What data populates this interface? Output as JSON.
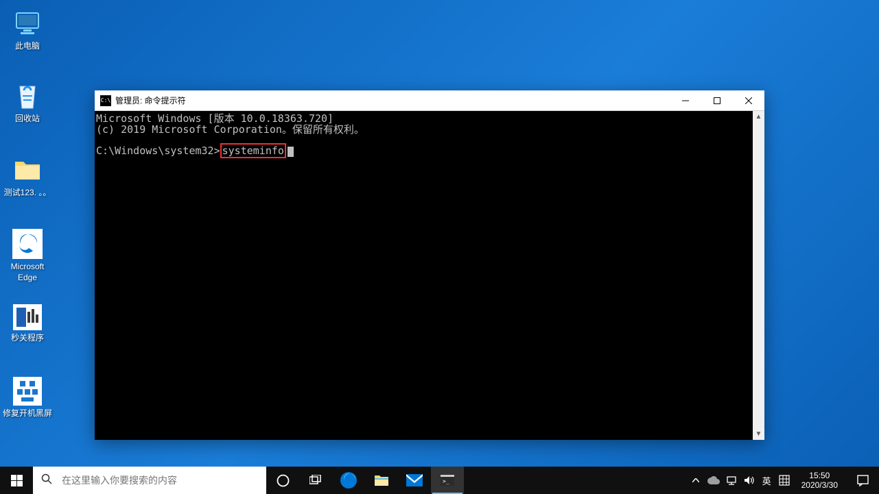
{
  "desktop": {
    "icons": [
      {
        "name": "此电脑",
        "icon": "pc"
      },
      {
        "name": "回收站",
        "icon": "recycle"
      },
      {
        "name": "测试123. 。。",
        "icon": "folder"
      },
      {
        "name": "Microsoft Edge",
        "icon": "edge"
      },
      {
        "name": "秒关程序",
        "icon": "app1"
      },
      {
        "name": "修复开机黑屏",
        "icon": "app2"
      }
    ]
  },
  "cmd": {
    "title_icon": "C:\\",
    "title": "管理员: 命令提示符",
    "line1": "Microsoft Windows [版本 10.0.18363.720]",
    "line2": "(c) 2019 Microsoft Corporation。保留所有权利。",
    "prompt": "C:\\Windows\\system32>",
    "command": "systeminfo"
  },
  "taskbar": {
    "search_placeholder": "在这里输入你要搜索的内容",
    "ime_lang": "英",
    "time": "15:50",
    "date": "2020/3/30"
  }
}
